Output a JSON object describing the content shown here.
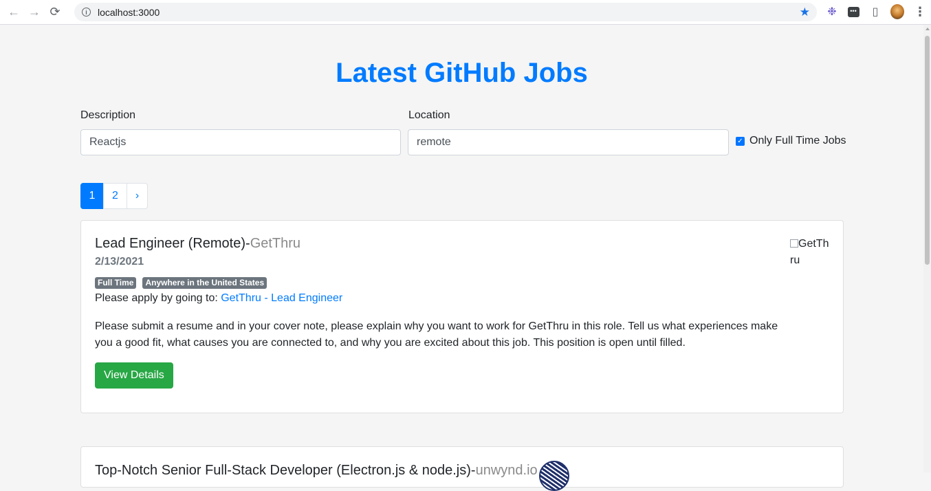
{
  "browser": {
    "url": "localhost:3000",
    "back_icon": "arrow-left-icon",
    "forward_icon": "arrow-right-icon",
    "reload_icon": "reload-icon",
    "info_icon": "info-icon",
    "bookmark_icon": "star-icon",
    "extensions": [
      "puzzle-icon"
    ]
  },
  "page": {
    "title": "Latest GitHub Jobs"
  },
  "search": {
    "description_label": "Description",
    "description_value": "Reactjs",
    "location_label": "Location",
    "location_value": "remote",
    "full_time_label": "Only Full Time Jobs",
    "full_time_checked": true
  },
  "pagination": {
    "pages": [
      "1",
      "2"
    ],
    "next": "›",
    "active_page": "1"
  },
  "jobs": [
    {
      "title": "Lead Engineer (Remote)",
      "separator": "-",
      "company": "GetThru",
      "date": "2/13/2021",
      "badges": [
        "Full Time",
        "Anywhere in the United States"
      ],
      "apply_prefix": "Please apply by going to: ",
      "apply_link": "GetThru - Lead Engineer",
      "description": "Please submit a resume and in your cover note, please explain why you want to work for GetThru in this role. Tell us what experiences make you a good fit, what causes you are connected to, and why you are excited about this job. This position is open until filled.",
      "button": "View Details",
      "logo_alt": "GetThru"
    },
    {
      "title": "Top-Notch Senior Full-Stack Developer (Electron.js & node.js)",
      "separator": "-",
      "company": "unwynd.io"
    }
  ],
  "colors": {
    "primary": "#007bff",
    "success": "#28a745",
    "badge": "#6c757d"
  }
}
